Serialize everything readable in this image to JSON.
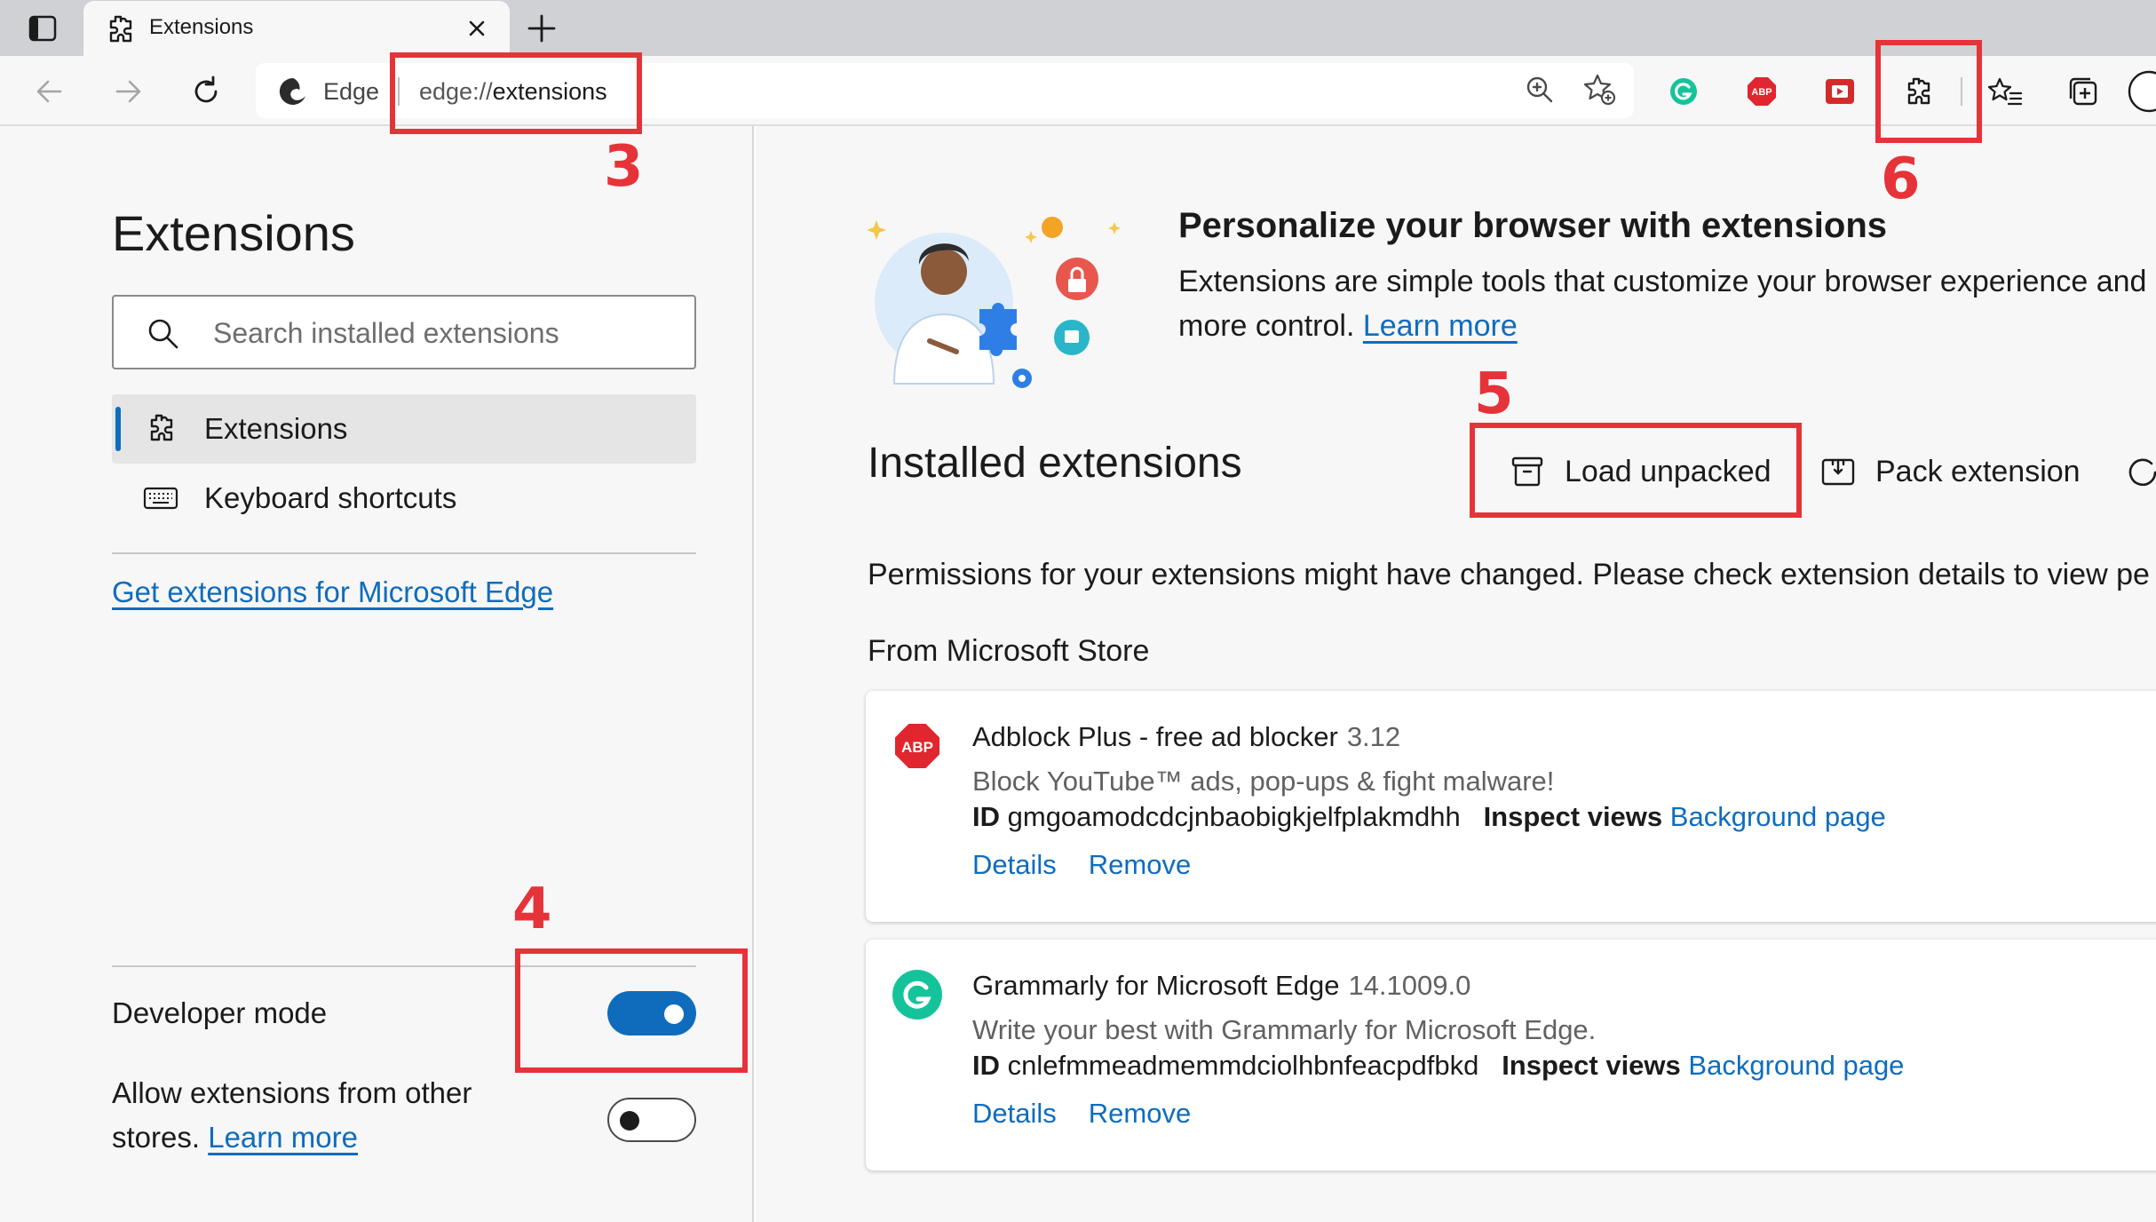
{
  "tab": {
    "title": "Extensions"
  },
  "omnibox": {
    "site_label": "Edge",
    "url_scheme": "edge://",
    "url_path": "extensions"
  },
  "toolbar": {
    "icons": [
      "back-icon",
      "forward-icon",
      "refresh-icon",
      "zoom-icon",
      "add-favorite-icon",
      "grammarly-icon",
      "adblock-plus-icon",
      "video-extension-icon",
      "extensions-icon",
      "favorites-icon",
      "collections-icon",
      "profile-icon"
    ]
  },
  "sidebar": {
    "title": "Extensions",
    "search_placeholder": "Search installed extensions",
    "nav": [
      {
        "label": "Extensions",
        "active": true
      },
      {
        "label": "Keyboard shortcuts",
        "active": false
      }
    ],
    "get_extensions_link": "Get extensions for Microsoft Edge",
    "developer_mode": {
      "label": "Developer mode",
      "enabled": true
    },
    "other_stores": {
      "label": "Allow extensions from other stores.",
      "link": "Learn more",
      "enabled": false
    }
  },
  "main": {
    "hero": {
      "title": "Personalize your browser with extensions",
      "desc_line1": "Extensions are simple tools that customize your browser experience and",
      "desc_line2": "more control.",
      "learn_more": "Learn more"
    },
    "installed_title": "Installed extensions",
    "actions": {
      "load_unpacked": "Load unpacked",
      "pack_extension": "Pack extension"
    },
    "permissions_message": "Permissions for your extensions might have changed. Please check extension details to view pe",
    "store_heading": "From Microsoft Store",
    "extensions": [
      {
        "name": "Adblock Plus - free ad blocker",
        "version": "3.12",
        "description": "Block YouTube™ ads, pop-ups & fight malware!",
        "id_label": "ID",
        "id": "gmgoamodcdcjnbaobigkjelfplakmdhh",
        "inspect_label": "Inspect views",
        "inspect_link": "Background page",
        "details": "Details",
        "remove": "Remove"
      },
      {
        "name": "Grammarly for Microsoft Edge",
        "version": "14.1009.0",
        "description": "Write your best with Grammarly for Microsoft Edge.",
        "id_label": "ID",
        "id": "cnlefmmeadmemmdciolhbnfeacpdfbkd",
        "inspect_label": "Inspect views",
        "inspect_link": "Background page",
        "details": "Details",
        "remove": "Remove"
      }
    ]
  },
  "annotations": {
    "step3": "3",
    "step4": "4",
    "step5": "5",
    "step6": "6"
  },
  "colors": {
    "accent": "#0f6cbd",
    "annotation": "#e63339",
    "abp_red": "#e0262e",
    "grammarly_green": "#15c39a"
  }
}
